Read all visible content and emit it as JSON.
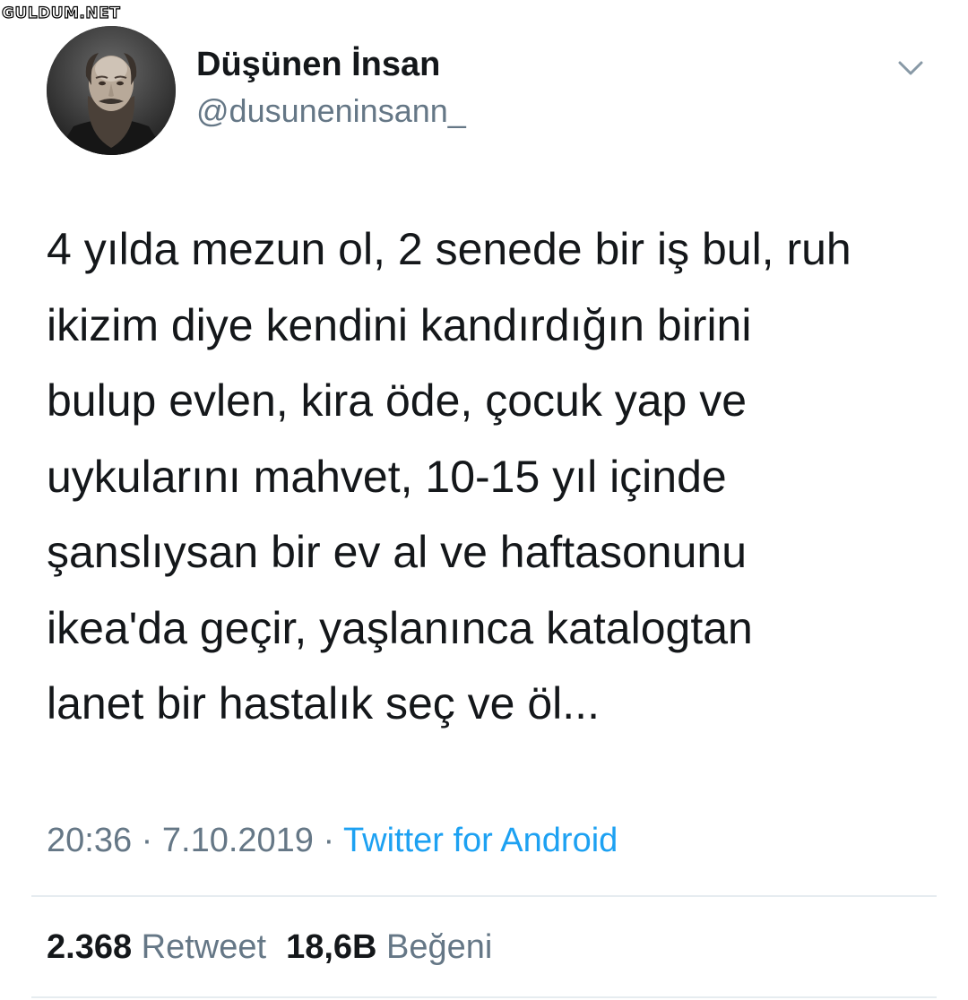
{
  "watermark": "GULDUM.NET",
  "user": {
    "display_name": "Düşünen İnsan",
    "handle": "@dusuneninsann_"
  },
  "tweet": {
    "lines": [
      "4 yılda mezun ol, 2 senede bir iş bul, ruh",
      "ikizim diye kendini kandırdığın birini",
      "bulup evlen, kira öde, çocuk yap ve",
      "uykularını mahvet, 10-15 yıl içinde",
      "şanslıysan bir ev al ve haftasonunu",
      "ikea'da geçir, yaşlanınca katalogtan",
      "lanet bir hastalık seç ve öl..."
    ]
  },
  "meta": {
    "time": "20:36",
    "separator": " · ",
    "date": "7.10.2019",
    "source": "Twitter for Android"
  },
  "stats": {
    "retweet_count": "2.368",
    "retweet_label": "Retweet",
    "like_count": "18,6B",
    "like_label": "Beğeni"
  },
  "icons": {
    "more_menu": "chevron-down-icon"
  },
  "colors": {
    "text": "#14171a",
    "secondary": "#657786",
    "link": "#1da1f2",
    "divider": "#e6ecf0"
  }
}
